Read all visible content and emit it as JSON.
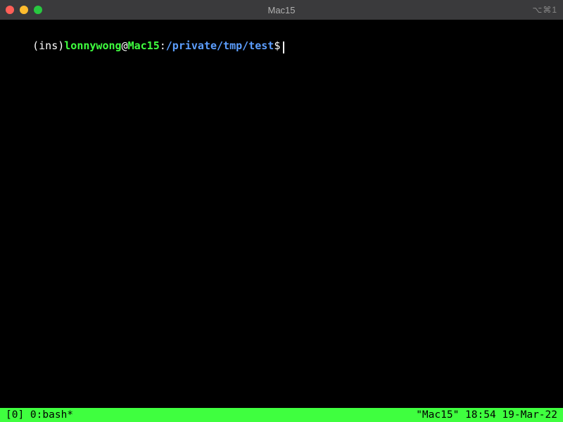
{
  "window": {
    "title": "Mac15",
    "right_indicator": "⌥⌘1"
  },
  "prompt": {
    "mode_open": "(",
    "mode": "ins",
    "mode_close": ")",
    "user": "lonnywong",
    "at": "@",
    "host": "Mac15",
    "colon": ":",
    "path": "/private/tmp/test",
    "dollar": "$"
  },
  "statusbar": {
    "left": "[0] 0:bash*",
    "right": "\"Mac15\" 18:54 19-Mar-22"
  },
  "colors": {
    "background": "#000000",
    "titlebar": "#3a3a3c",
    "statusbar": "#3fff3f",
    "prompt_user_host": "#3fff3f",
    "prompt_path": "#5c9eff"
  }
}
